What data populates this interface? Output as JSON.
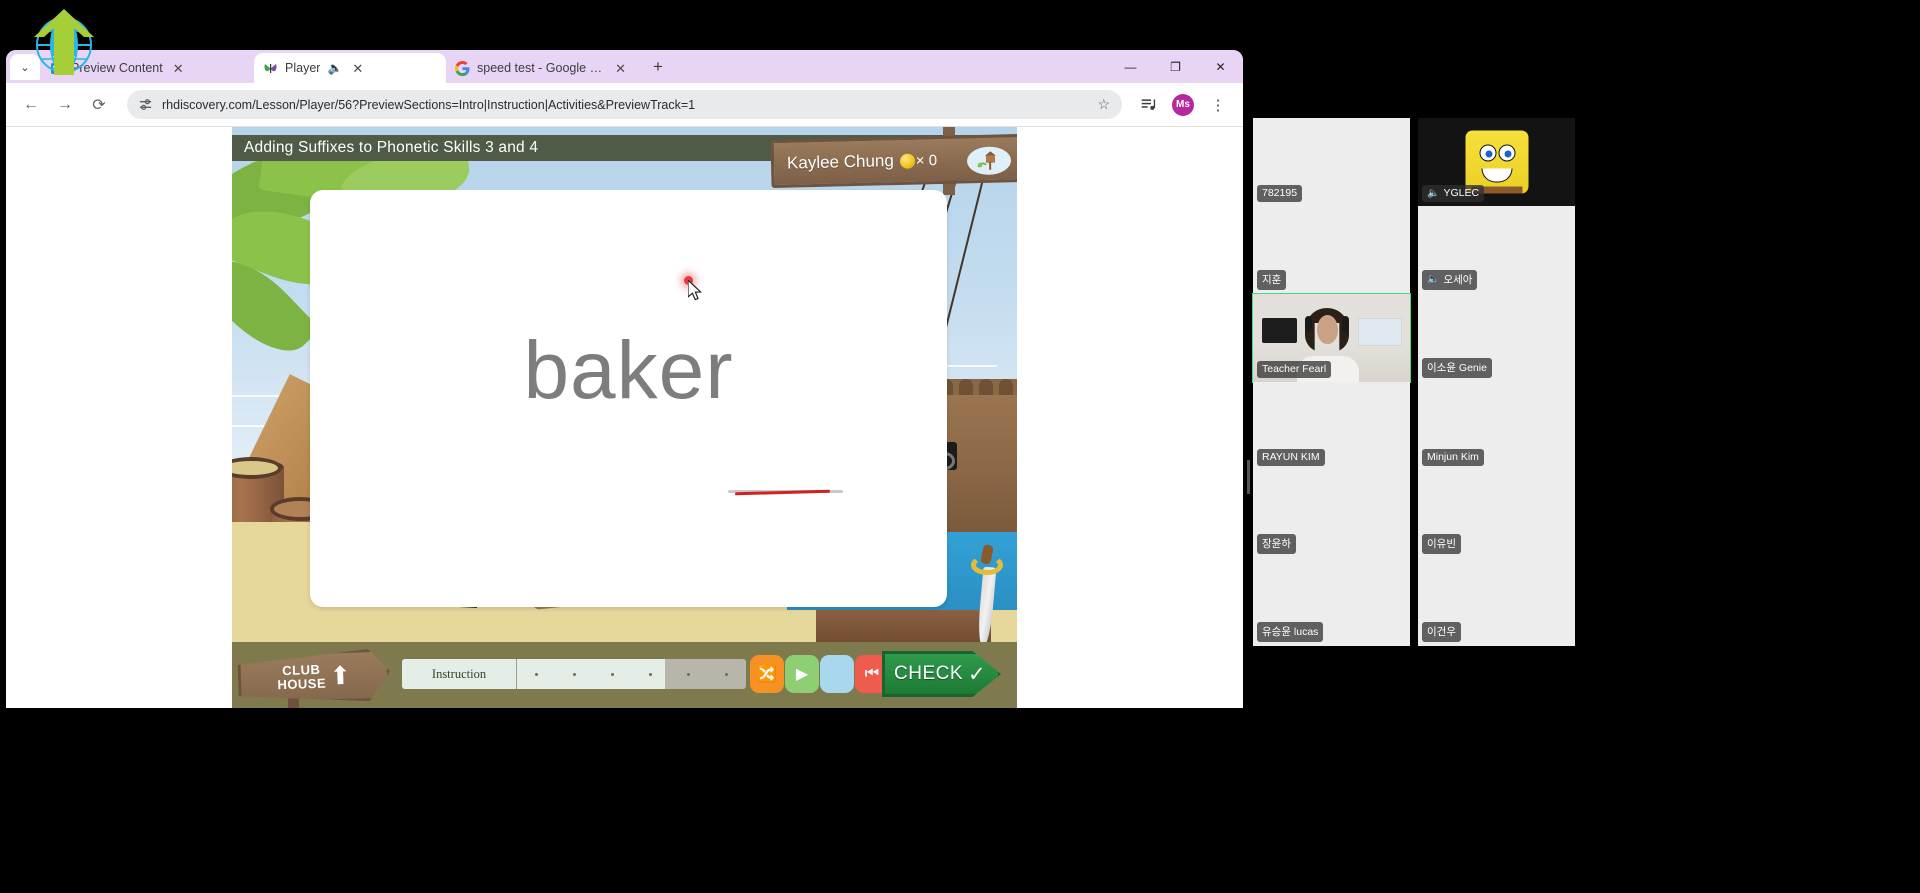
{
  "browser": {
    "tabs": [
      {
        "label": "Preview Content",
        "favicon": "ebook-icon",
        "has_sound": false,
        "active": false
      },
      {
        "label": "Player",
        "favicon": "butterfly-icon",
        "has_sound": true,
        "active": true
      },
      {
        "label": "speed test - Google Search",
        "favicon": "google-icon",
        "has_sound": false,
        "active": false
      }
    ],
    "new_tab_label": "+",
    "tab_list_chevron": "⌄",
    "window_controls": {
      "minimize": "—",
      "maximize": "❐",
      "close": "✕"
    },
    "nav": {
      "back": "←",
      "forward": "→",
      "reload": "⟳"
    },
    "omnibox": {
      "url": "rhdiscovery.com/Lesson/Player/56?PreviewSections=Intro|Instruction|Activities&PreviewTrack=1",
      "site_settings_icon": "tune-icon",
      "bookmark_icon": "☆"
    },
    "toolbar": {
      "media_icon": "☰",
      "profile_initials": "Ms",
      "menu_icon": "⋮"
    }
  },
  "game": {
    "title": "Adding Suffixes to Phonetic Skills 3 and 4",
    "player_name": "Kaylee Chung",
    "coin_multiplier": "× 0",
    "coin_icon": "gold-coin",
    "hut_badge_icon": "treehouse-icon",
    "card": {
      "word": "baker"
    },
    "toolbar": {
      "club_house_line1": "CLUB",
      "club_house_line2": "HOUSE",
      "club_house_arrow": "⬆",
      "progress_label": "Instruction",
      "buttons": [
        {
          "name": "shuffle-button",
          "glyph": "🔀",
          "color": "#f59223"
        },
        {
          "name": "play-button",
          "glyph": "▶",
          "color": "#8dcf72"
        },
        {
          "name": "blank-button",
          "glyph": "",
          "color": "#a9d8ee"
        },
        {
          "name": "rewind-button",
          "glyph": "⏮",
          "color": "#ef5b4c"
        }
      ],
      "check_label": "CHECK",
      "check_tick": "✓"
    }
  },
  "video_panel": {
    "participants": [
      {
        "name": "782195",
        "muted": false,
        "selected": false,
        "kind": "blank"
      },
      {
        "name": "YGLEC",
        "muted": true,
        "selected": false,
        "kind": "spongebob"
      },
      {
        "name": "지훈",
        "muted": false,
        "selected": false,
        "kind": "blank"
      },
      {
        "name": "오세아",
        "muted": true,
        "selected": false,
        "kind": "blank"
      },
      {
        "name": "Teacher Fearl",
        "muted": false,
        "selected": true,
        "kind": "teacher"
      },
      {
        "name": "이소윤 Genie",
        "muted": false,
        "selected": false,
        "kind": "blank"
      },
      {
        "name": "RAYUN KIM",
        "muted": false,
        "selected": false,
        "kind": "blank"
      },
      {
        "name": "Minjun Kim",
        "muted": false,
        "selected": false,
        "kind": "blank"
      },
      {
        "name": "장윤하",
        "muted": false,
        "selected": false,
        "kind": "blank"
      },
      {
        "name": "이유빈",
        "muted": false,
        "selected": false,
        "kind": "blank"
      },
      {
        "name": "유승윤 lucas",
        "muted": false,
        "selected": false,
        "kind": "blank"
      },
      {
        "name": "이건우",
        "muted": false,
        "selected": false,
        "kind": "blank"
      }
    ],
    "mute_glyph": "🔇"
  },
  "colors": {
    "tab_strip": "#e8d5f5",
    "accent_green": "#3ddc84",
    "check_green": "#2f9b4a",
    "profile_purple": "#b5289e",
    "word_gray": "#7d7d7d",
    "red_mark": "#cf2222"
  }
}
